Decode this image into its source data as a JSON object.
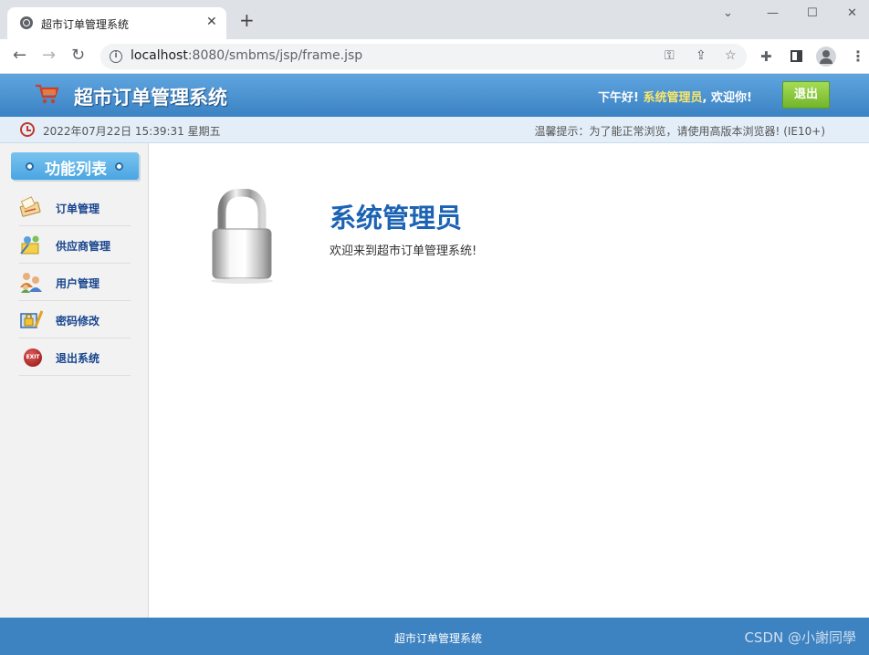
{
  "browser": {
    "tab_title": "超市订单管理系统",
    "url_host": "localhost",
    "url_path": ":8080/smbms/jsp/frame.jsp"
  },
  "header": {
    "app_title": "超市订单管理系统",
    "greeting": "下午好!",
    "username": "系统管理员",
    "welcome_suffix": ", 欢迎你!",
    "logout_label": "退出"
  },
  "subbar": {
    "datetime": "2022年07月22日 15:39:31 星期五",
    "tip": "温馨提示：为了能正常浏览，请使用高版本浏览器!",
    "tip_ie": "(IE10+)"
  },
  "sidebar": {
    "title": "功能列表",
    "items": [
      {
        "label": "订单管理",
        "icon": "order-icon"
      },
      {
        "label": "供应商管理",
        "icon": "supplier-icon"
      },
      {
        "label": "用户管理",
        "icon": "users-icon"
      },
      {
        "label": "密码修改",
        "icon": "password-icon"
      },
      {
        "label": "退出系统",
        "icon": "exit-icon"
      }
    ]
  },
  "main": {
    "title": "系统管理员",
    "welcome": "欢迎来到超市订单管理系统!"
  },
  "footer": {
    "text": "超市订单管理系统",
    "watermark": "CSDN @小謝同學"
  },
  "colors": {
    "header_blue": "#3b82c4",
    "title_blue": "#1c63b3",
    "logout_green": "#72b52c",
    "username_yellow": "#f9e66a"
  }
}
